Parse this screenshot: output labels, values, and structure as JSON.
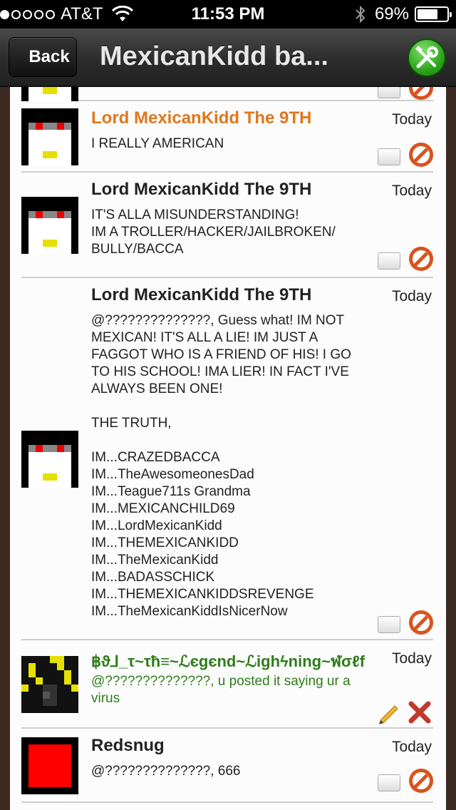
{
  "status_bar": {
    "carrier": "AT&T",
    "signal_bars": 1,
    "time": "11:53 PM",
    "battery": "69%",
    "battery_level": 0.69
  },
  "nav": {
    "back_label": "Back",
    "title": "MexicanKidd ba...",
    "tools_icon": "tools-icon"
  },
  "colors": {
    "highlight_name": "#e0761c",
    "green_name": "#2e7d1a",
    "prohibit": "#d9531e",
    "delete_x": "#c0392b"
  },
  "posts": [
    {
      "name": "Lord MexicanKidd The 9TH",
      "name_color": "orange",
      "date": "Today",
      "message": "I REALLY AMERICAN",
      "actions": [
        "reply-icon",
        "block-icon"
      ]
    },
    {
      "name": "Lord MexicanKidd The 9TH",
      "date": "Today",
      "message": "IT'S ALLA MISUNDERSTANDING!\nIM A TROLLER/HACKER/JAILBROKEN/\nBULLY/BACCA",
      "actions": [
        "reply-icon",
        "block-icon"
      ]
    },
    {
      "name": "Lord MexicanKidd The 9TH",
      "date": "Today",
      "message": "@??????????????, Guess what! IM NOT\nMEXICAN! IT'S ALL A LIE! IM JUST A\nFAGGOT WHO IS A FRIEND OF HIS! I GO\nTO HIS SCHOOL! IMA LIER! IN FACT I'VE\nALWAYS BEEN ONE!\n\nTHE TRUTH,\n\nIM...CRAZEDBACCA\nIM...TheAwesomeonesDad\nIM...Teague711s Grandma\nIM...MEXICANCHILD69\nIM...LordMexicanKidd\nIM...THEMEXICANKIDD\nIM...TheMexicanKidd\nIM...BADASSCHICK\nIM...THEMEXICANKIDDSREVENGE\nIM...TheMexicanKiddIsNicerNow",
      "actions": [
        "reply-icon",
        "block-icon"
      ]
    },
    {
      "name": "฿ϑ⅃_τ~τħ≡~ℒєgєnd~ℒighϟning~ฬσℓf",
      "name_color": "green",
      "date": "Today",
      "message": "@??????????????, u posted it saying ur a\nvirus",
      "actions": [
        "edit-icon",
        "delete-icon"
      ]
    },
    {
      "name": "Redsnug",
      "date": "Today",
      "message": "@??????????????, 666",
      "actions": [
        "reply-icon",
        "block-icon"
      ]
    }
  ]
}
